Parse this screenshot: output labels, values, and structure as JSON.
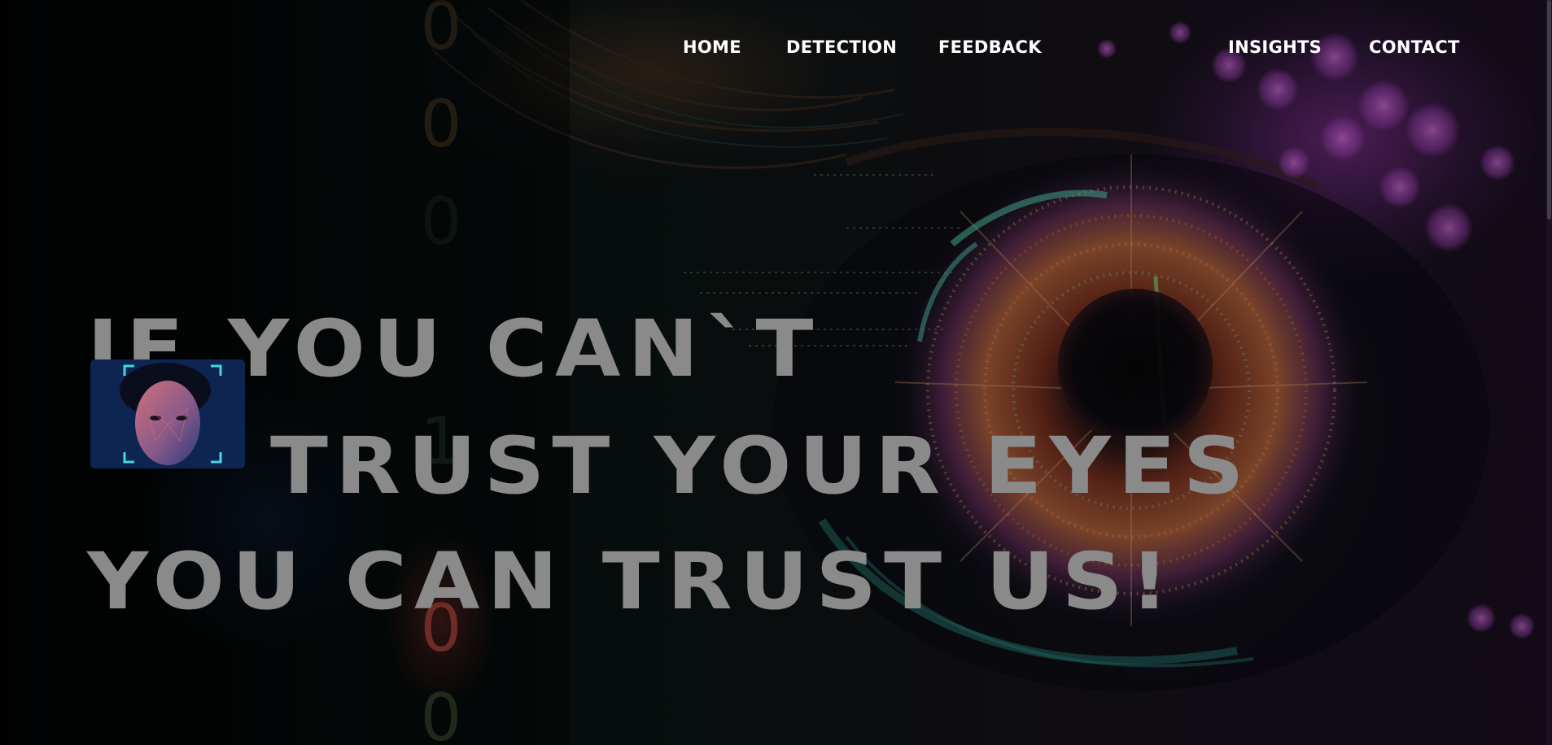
{
  "nav": {
    "items": [
      {
        "label": "HOME"
      },
      {
        "label": "DETECTION"
      },
      {
        "label": "FEEDBACK"
      },
      {
        "label": "INSIGHTS"
      },
      {
        "label": "CONTACT"
      }
    ]
  },
  "hero": {
    "line1": "IF YOU CAN`T",
    "line2": "TRUST YOUR EYES",
    "line3": "YOU CAN TRUST US!",
    "thumbnail_icon": "face-scan-icon"
  },
  "colors": {
    "headline": "#8a8a8a",
    "nav_text": "#ffffff",
    "background": "#050608",
    "accent_cyan": "#33c9d6",
    "accent_magenta": "#c04ad0",
    "accent_red": "#e04a3a"
  }
}
